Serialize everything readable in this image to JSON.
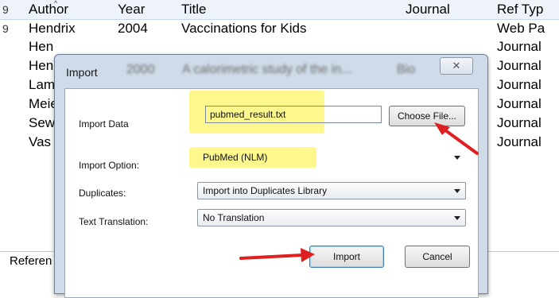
{
  "library": {
    "columns": {
      "num": "9",
      "author": "Author",
      "year": "Year",
      "title": "Title",
      "journal": "Journal",
      "ref_type": "Ref Typ"
    },
    "rows": [
      {
        "num": "9",
        "author": "Hendrix",
        "year": "2004",
        "title": "Vaccinations for Kids",
        "journal": "",
        "ref_type": "Web Pa"
      },
      {
        "num": "",
        "author": "Hen",
        "year": "",
        "title": "",
        "journal": "",
        "ref_type": "Journal"
      },
      {
        "num": "",
        "author": "Hen",
        "year": "",
        "title": "",
        "journal": "",
        "ref_type": "Journal"
      },
      {
        "num": "",
        "author": "Lam",
        "year": "",
        "title": "",
        "journal": "",
        "ref_type": "Journal"
      },
      {
        "num": "",
        "author": "Meie",
        "year": "",
        "title": "",
        "journal": "",
        "ref_type": "Journal"
      },
      {
        "num": "",
        "author": "Sew",
        "year": "",
        "title": "",
        "journal": "",
        "ref_type": "Journal"
      },
      {
        "num": "",
        "author": "Vas",
        "year": "",
        "title": "",
        "journal": "",
        "ref_type": "Journal"
      }
    ],
    "blurred_row": {
      "year": "2000",
      "title": "A calorimetric study of the in...",
      "journal": "Bio"
    },
    "reference_label": "Referen"
  },
  "dialog": {
    "title": "Import",
    "close_glyph": "✕",
    "import_data_label": "Import Data",
    "import_data_value": "pubmed_result.txt",
    "choose_file_label": "Choose File...",
    "import_option_label": "Import Option:",
    "import_option_value": "PubMed (NLM)",
    "duplicates_label": "Duplicates:",
    "duplicates_value": "Import into Duplicates Library",
    "text_translation_label": "Text Translation:",
    "text_translation_value": "No Translation",
    "import_button": "Import",
    "cancel_button": "Cancel"
  },
  "colors": {
    "highlight": "#fbf77a",
    "annotation_arrow": "#e02020",
    "dialog_frame": "#cfdbe9"
  }
}
